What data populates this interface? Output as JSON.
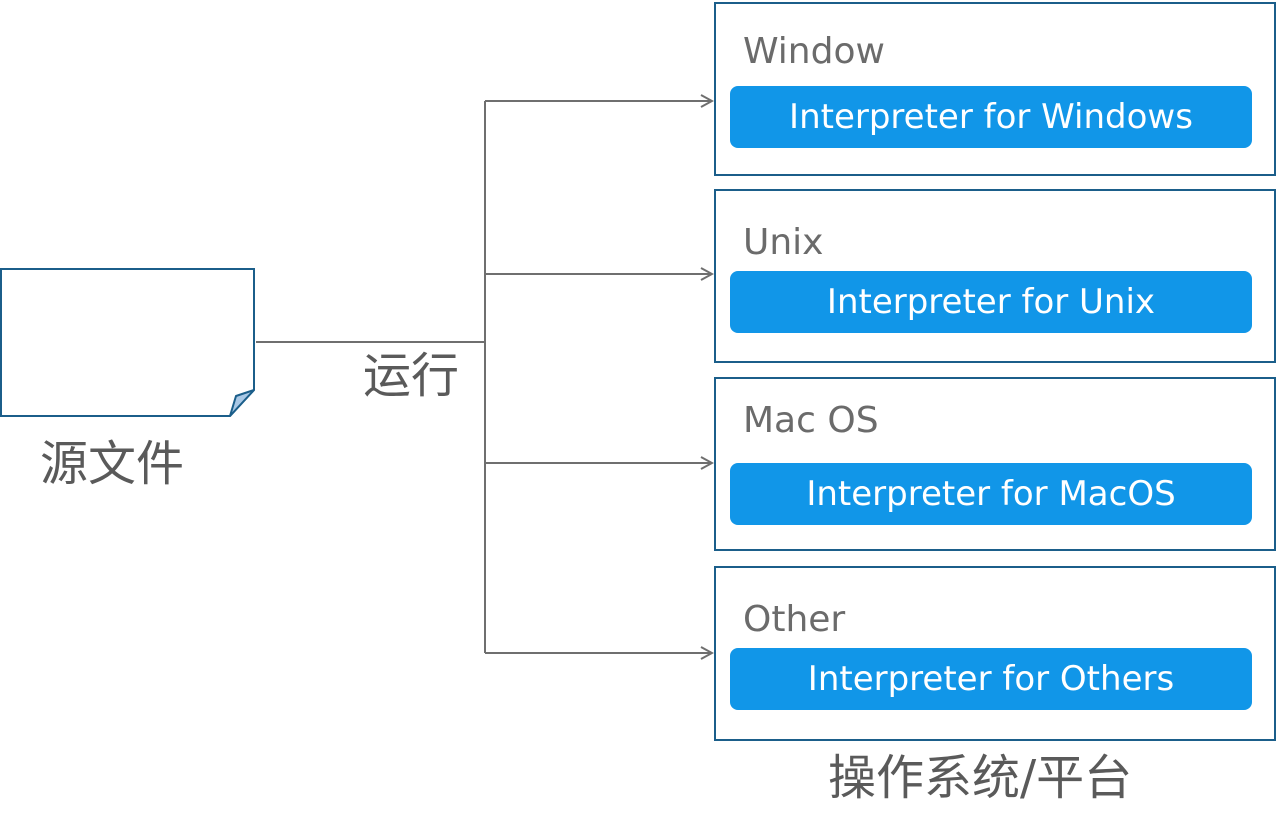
{
  "source": {
    "label": "源文件"
  },
  "run_label": "运行",
  "platform_group_label": "操作系统/平台",
  "platforms": [
    {
      "name": "Window",
      "interpreter": "Interpreter for Windows"
    },
    {
      "name": "Unix",
      "interpreter": "Interpreter for Unix"
    },
    {
      "name": "Mac OS",
      "interpreter": "Interpreter for MacOS"
    },
    {
      "name": "Other",
      "interpreter": "Interpreter for Others"
    }
  ],
  "colors": {
    "box_border": "#1b5e8a",
    "button_fill": "#1196e8",
    "connector": "#6f6f6f",
    "text_gray": "#5a5a5a",
    "doc_fold": "#a9c8e6"
  }
}
